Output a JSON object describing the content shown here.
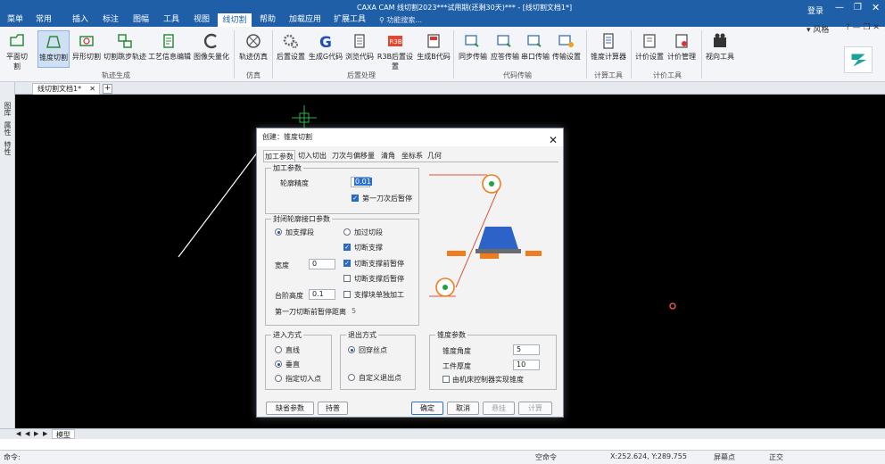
{
  "titlebar": {
    "title": "CAXA CAM 线切割2023***试用期(还剩30天)*** - [线切割文档1*]",
    "tabs": [
      "菜单",
      "常用",
      "插入",
      "标注",
      "图幅",
      "工具",
      "视图",
      "线切割",
      "帮助",
      "加载应用",
      "扩展工具"
    ],
    "active_tab": "线切割",
    "search_placeholder": "功能搜索...",
    "login": "登录",
    "style_label": "风格"
  },
  "ribbon": {
    "buttons": [
      {
        "label": "平面切割",
        "icon": "plane-cut-icon"
      },
      {
        "label": "锥度切割",
        "icon": "taper-cut-icon",
        "active": true
      },
      {
        "label": "异形切割",
        "icon": "shape-cut-icon"
      },
      {
        "label": "切割跳步轨迹",
        "icon": "jump-track-icon"
      },
      {
        "label": "工艺信息编辑",
        "icon": "process-edit-icon"
      },
      {
        "label": "图像矢量化",
        "icon": "vectorize-icon"
      },
      {
        "label": "轨迹仿真",
        "icon": "simulate-icon"
      },
      {
        "label": "后置设置",
        "icon": "post-settings-icon"
      },
      {
        "label": "生成G代码",
        "icon": "g-code-icon"
      },
      {
        "label": "浏览代码",
        "icon": "browse-code-icon"
      },
      {
        "label": "R3B后置设置",
        "icon": "r3b-icon"
      },
      {
        "label": "生成B代码",
        "icon": "b-code-icon"
      },
      {
        "label": "同步传输",
        "icon": "sync-transfer-icon"
      },
      {
        "label": "应答传输",
        "icon": "ack-transfer-icon"
      },
      {
        "label": "串口传输",
        "icon": "serial-transfer-icon"
      },
      {
        "label": "传输设置",
        "icon": "transfer-settings-icon"
      },
      {
        "label": "锥度计算器",
        "icon": "taper-calc-icon"
      },
      {
        "label": "计价设置",
        "icon": "price-settings-icon"
      },
      {
        "label": "计价管理",
        "icon": "price-manage-icon"
      },
      {
        "label": "视向工具",
        "icon": "view-tool-icon"
      }
    ],
    "groups": [
      "轨迹生成",
      "仿真",
      "后置处理",
      "代码传输",
      "计算工具",
      "计价工具"
    ]
  },
  "document": {
    "tab": "线切割文档1*",
    "side_labels": [
      "图库",
      "属性",
      "特性"
    ],
    "bottom_tab": "模型"
  },
  "statusbar": {
    "command_label": "命令:",
    "command_state": "空命令",
    "coords": "X:252.624, Y:289.755",
    "snap": "屏幕点",
    "mode": "正交"
  },
  "dialog": {
    "title": "创建：锥度切割",
    "tabs": [
      "加工参数",
      "切入切出",
      "刀次与偏移量",
      "清角",
      "坐标系",
      "几何"
    ],
    "active_tab": "加工参数",
    "process": {
      "legend": "加工参数",
      "contour_precision_label": "轮廓精度",
      "contour_precision": "0.01",
      "pause_first_pass": "第一刀次后暂停",
      "pause_first_pass_checked": true
    },
    "closed_contour": {
      "legend": "封闭轮廓接口参数",
      "add_support": "加支撑段",
      "add_support_selected": true,
      "add_cut": "加过切段",
      "cut_support": "切断支撑",
      "cut_support_checked": true,
      "width_label": "宽度",
      "width": "0",
      "pause_before_cut": "切断支撑前暂停",
      "pause_before_cut_checked": true,
      "pause_after_cut": "切断支撑后暂停",
      "pause_after_cut_checked": false,
      "step_height_label": "台阶高度",
      "step_height": "0.1",
      "support_separate": "支撑块单独加工",
      "support_separate_checked": false,
      "first_pause_distance_label": "第一刀切断前暂停距离",
      "first_pause_distance": "5"
    },
    "entry": {
      "legend": "进入方式",
      "options": [
        "直线",
        "垂直",
        "指定切入点"
      ],
      "selected": 1
    },
    "exit": {
      "legend": "退出方式",
      "options": [
        "回穿丝点",
        "自定义退出点"
      ],
      "selected": 0
    },
    "taper": {
      "legend": "锥度参数",
      "angle_label": "锥度角度",
      "angle": "5",
      "thickness_label": "工件厚度",
      "thickness": "10",
      "machine_taper": "由机床控制器实现锥度",
      "machine_taper_checked": false
    },
    "buttons": {
      "defaults": "缺省参数",
      "keep": "持普",
      "ok": "确定",
      "cancel": "取消",
      "hang": "悬挂",
      "calc": "计算"
    }
  }
}
